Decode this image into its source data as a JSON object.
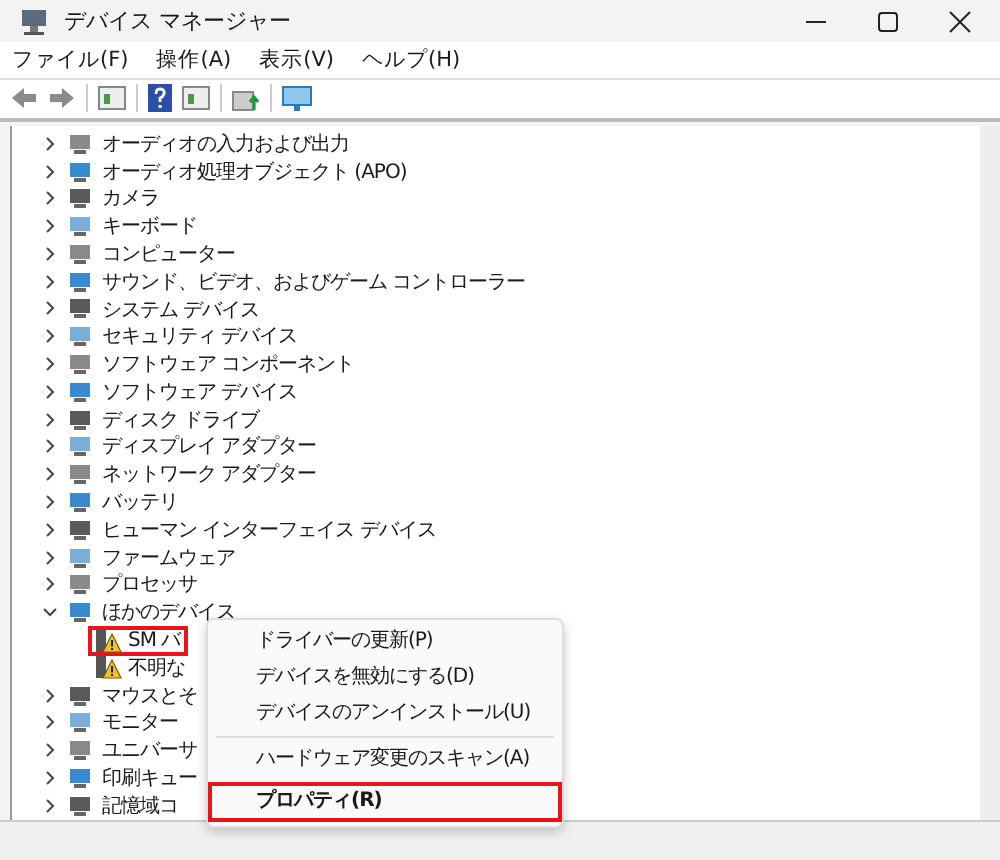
{
  "window": {
    "title": "デバイス マネージャー"
  },
  "menu": [
    "ファイル(F)",
    "操作(A)",
    "表示(V)",
    "ヘルプ(H)"
  ],
  "tree": [
    {
      "label": "オーディオの入力および出力",
      "expanded": false
    },
    {
      "label": "オーディオ処理オブジェクト (APO)",
      "expanded": false
    },
    {
      "label": "カメラ",
      "expanded": false
    },
    {
      "label": "キーボード",
      "expanded": false
    },
    {
      "label": "コンピューター",
      "expanded": false
    },
    {
      "label": "サウンド、ビデオ、およびゲーム コントローラー",
      "expanded": false
    },
    {
      "label": "システム デバイス",
      "expanded": false
    },
    {
      "label": "セキュリティ デバイス",
      "expanded": false
    },
    {
      "label": "ソフトウェア コンポーネント",
      "expanded": false
    },
    {
      "label": "ソフトウェア デバイス",
      "expanded": false
    },
    {
      "label": "ディスク ドライブ",
      "expanded": false
    },
    {
      "label": "ディスプレイ アダプター",
      "expanded": false
    },
    {
      "label": "ネットワーク アダプター",
      "expanded": false
    },
    {
      "label": "バッテリ",
      "expanded": false
    },
    {
      "label": "ヒューマン インターフェイス デバイス",
      "expanded": false
    },
    {
      "label": "ファームウェア",
      "expanded": false
    },
    {
      "label": "プロセッサ",
      "expanded": false
    },
    {
      "label": "ほかのデバイス",
      "expanded": true,
      "children": [
        {
          "label": "SM バ",
          "warning": true,
          "highlighted": true
        },
        {
          "label": "不明な",
          "warning": true,
          "highlighted": false
        }
      ]
    },
    {
      "label": "マウスとそ",
      "expanded": false
    },
    {
      "label": "モニター",
      "expanded": false
    },
    {
      "label": "ユニバーサ",
      "expanded": false
    },
    {
      "label": "印刷キュー",
      "expanded": false
    },
    {
      "label": "記憶域コ",
      "expanded": false
    }
  ],
  "context_menu": [
    {
      "label": "ドライバーの更新(P)",
      "bold": false,
      "highlighted": false
    },
    {
      "label": "デバイスを無効にする(D)",
      "bold": false,
      "highlighted": false
    },
    {
      "label": "デバイスのアンインストール(U)",
      "bold": false,
      "highlighted": false,
      "separator_after": true
    },
    {
      "label": "ハードウェア変更のスキャン(A)",
      "bold": false,
      "highlighted": false
    },
    {
      "label": "プロパティ(R)",
      "bold": true,
      "highlighted": true
    }
  ]
}
